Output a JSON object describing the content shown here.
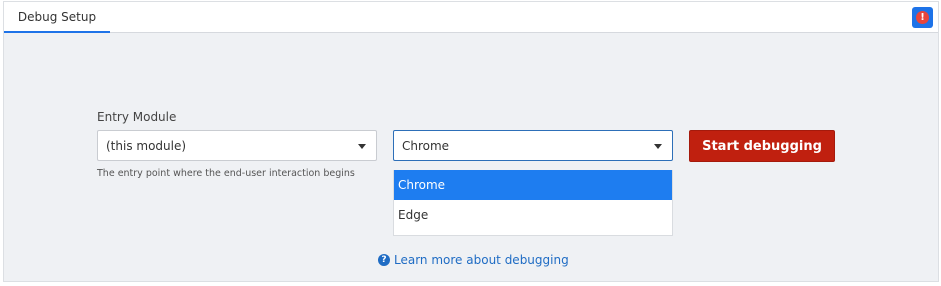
{
  "tabs": [
    {
      "label": "Debug Setup",
      "active": true
    }
  ],
  "alert": {
    "icon": "alert-icon",
    "glyph": "!",
    "color": "#e8453c",
    "bg": "#1e73e8"
  },
  "entry_module": {
    "label": "Entry Module",
    "value": "(this module)",
    "hint": "The entry point where the end-user interaction begins"
  },
  "browser_select": {
    "value": "Chrome",
    "options": [
      {
        "label": "Chrome",
        "selected": true
      },
      {
        "label": "Edge",
        "selected": false
      }
    ]
  },
  "start_button": {
    "label": "Start debugging",
    "color": "#c0200f"
  },
  "learn_more": {
    "label": "Learn more about debugging",
    "icon": "question-circle-icon",
    "glyph": "?"
  }
}
